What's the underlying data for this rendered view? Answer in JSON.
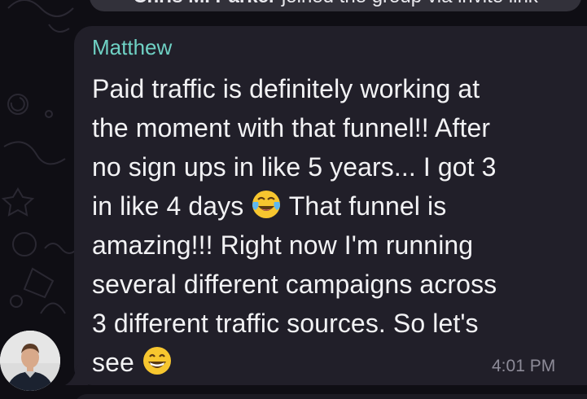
{
  "service_message": {
    "name": "Chris M. Parker",
    "text": " joined the group via invite link"
  },
  "message": {
    "sender": "Matthew",
    "lines": [
      "Paid traffic is definitely working at",
      "the moment with that funnel!! After",
      "no sign ups in like 5 years... I got 3",
      "in like 4 days ",
      " That funnel is",
      "amazing!!!  Right now I'm running",
      "several different campaigns across",
      "3 different traffic sources. So let's",
      "see "
    ],
    "emoji_1": "tears-of-joy-emoji",
    "emoji_2": "grinning-face-emoji",
    "time": "4:01 PM"
  },
  "avatar": {
    "icon": "user-avatar-photo"
  },
  "colors": {
    "background": "#0f0e14",
    "bubble": "#211f29",
    "sender": "#6fd1c4",
    "text": "#f2f2f4",
    "time": "#8d8b98"
  }
}
